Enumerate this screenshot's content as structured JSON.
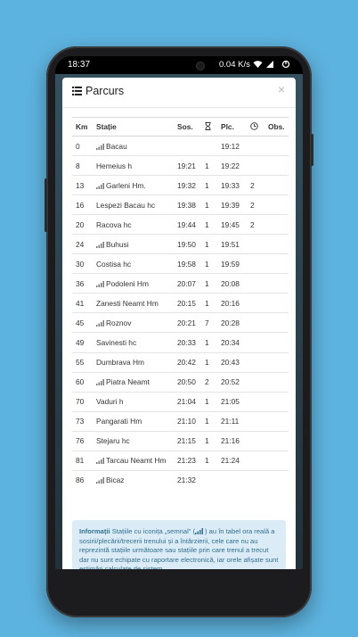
{
  "status_bar": {
    "time": "18:37",
    "network_speed": "0.04 K/s"
  },
  "modal": {
    "title": "Parcurs",
    "close_symbol": "×"
  },
  "table": {
    "headers": {
      "km": "Km",
      "station": "Stație",
      "arrival": "Sos.",
      "departure": "Plc.",
      "observations": "Obs."
    },
    "rows": [
      {
        "km": "0",
        "station": "Bacau",
        "signal": true,
        "arr": "",
        "delay": "",
        "dep": "19:12",
        "dwell": ""
      },
      {
        "km": "8",
        "station": "Hemeius h",
        "signal": false,
        "arr": "19:21",
        "delay": "1",
        "dep": "19:22",
        "dwell": ""
      },
      {
        "km": "13",
        "station": "Garleni Hm.",
        "signal": true,
        "arr": "19:32",
        "delay": "1",
        "dep": "19:33",
        "dwell": "2"
      },
      {
        "km": "16",
        "station": "Lespezi Bacau hc",
        "signal": false,
        "arr": "19:38",
        "delay": "1",
        "dep": "19:39",
        "dwell": "2"
      },
      {
        "km": "20",
        "station": "Racova hc",
        "signal": false,
        "arr": "19:44",
        "delay": "1",
        "dep": "19:45",
        "dwell": "2"
      },
      {
        "km": "24",
        "station": "Buhusi",
        "signal": true,
        "arr": "19:50",
        "delay": "1",
        "dep": "19:51",
        "dwell": ""
      },
      {
        "km": "30",
        "station": "Costisa hc",
        "signal": false,
        "arr": "19:58",
        "delay": "1",
        "dep": "19:59",
        "dwell": ""
      },
      {
        "km": "36",
        "station": "Podoleni Hm",
        "signal": true,
        "arr": "20:07",
        "delay": "1",
        "dep": "20:08",
        "dwell": ""
      },
      {
        "km": "41",
        "station": "Zanesti Neamt Hm",
        "signal": false,
        "arr": "20:15",
        "delay": "1",
        "dep": "20:16",
        "dwell": ""
      },
      {
        "km": "45",
        "station": "Roznov",
        "signal": true,
        "arr": "20:21",
        "delay": "7",
        "dep": "20:28",
        "dwell": ""
      },
      {
        "km": "49",
        "station": "Savinesti hc",
        "signal": false,
        "arr": "20:33",
        "delay": "1",
        "dep": "20:34",
        "dwell": ""
      },
      {
        "km": "55",
        "station": "Dumbrava Hm",
        "signal": false,
        "arr": "20:42",
        "delay": "1",
        "dep": "20:43",
        "dwell": ""
      },
      {
        "km": "60",
        "station": "Piatra Neamt",
        "signal": true,
        "arr": "20:50",
        "delay": "2",
        "dep": "20:52",
        "dwell": ""
      },
      {
        "km": "70",
        "station": "Vaduri h",
        "signal": false,
        "arr": "21:04",
        "delay": "1",
        "dep": "21:05",
        "dwell": ""
      },
      {
        "km": "73",
        "station": "Pangarati Hm",
        "signal": false,
        "arr": "21:10",
        "delay": "1",
        "dep": "21:11",
        "dwell": ""
      },
      {
        "km": "76",
        "station": "Stejaru hc",
        "signal": false,
        "arr": "21:15",
        "delay": "1",
        "dep": "21:16",
        "dwell": ""
      },
      {
        "km": "81",
        "station": "Tarcau Neamt Hm",
        "signal": true,
        "arr": "21:23",
        "delay": "1",
        "dep": "21:24",
        "dwell": ""
      },
      {
        "km": "86",
        "station": "Bicaz",
        "signal": true,
        "arr": "21:32",
        "delay": "",
        "dep": "",
        "dwell": ""
      }
    ]
  },
  "info": {
    "label": "Informații",
    "text_part1": " Stațiile cu iconița „semnal” (",
    "text_part2": ") au în tabel ora reală a sosirii/plecării/trecerii trenului și a întârzierii, cele care nu au reprezintă stațiile următoare sau stațiile prin care trenul a trecut dar nu sunt echipate cu raportare electronică, iar orele afișate sunt estimări calculate de sistem."
  },
  "colors": {
    "background": "#5db3df",
    "info_bg": "#dcecf7",
    "info_text": "#31708f"
  },
  "icons": [
    "list-icon",
    "hourglass-icon",
    "clock-icon",
    "signal-icon",
    "close-icon",
    "wifi-icon",
    "cell-signal-icon",
    "data-saver-icon"
  ]
}
